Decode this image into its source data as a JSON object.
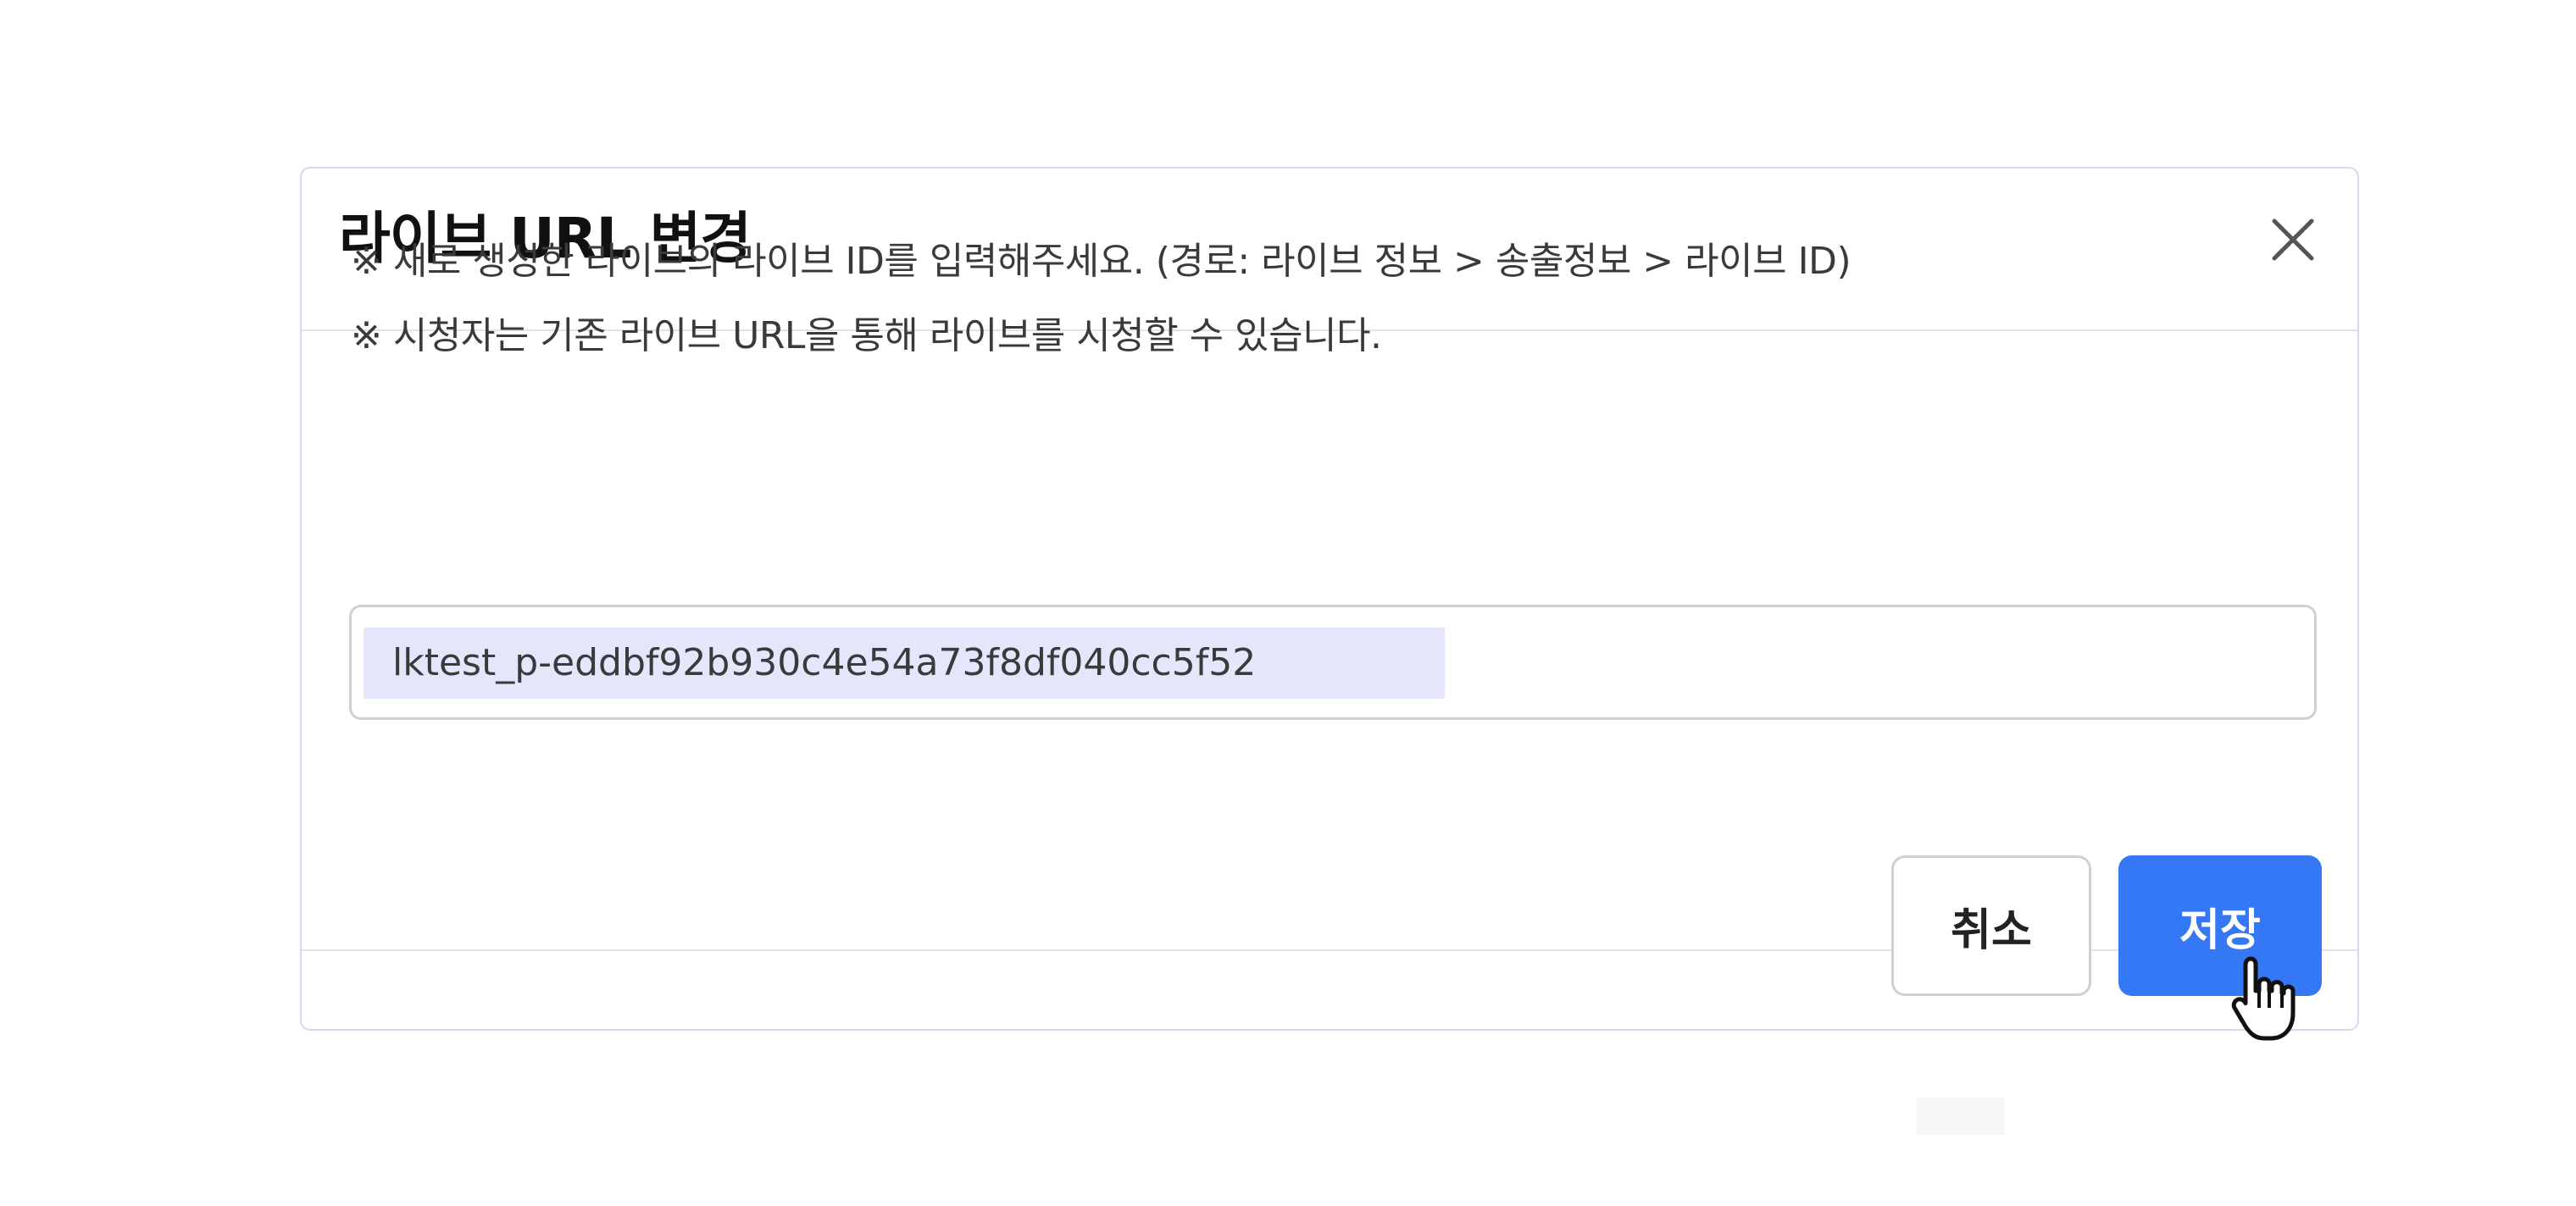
{
  "dialog": {
    "title": "라이브 URL 변경",
    "close_icon": "close-icon",
    "notices": [
      "※ 새로 생성한 라이브의 라이브 ID를 입력해주세요. (경로: 라이브 정보 > 송출정보 > 라이브 ID)",
      "※ 시청자는 기존 라이브 URL을 통해 라이브를 시청할 수 있습니다."
    ],
    "live_id_input": {
      "value": "lktest_p-eddbf92b930c4e54a73f8df040cc5f52"
    },
    "cancel_label": "취소",
    "save_label": "저장"
  },
  "colors": {
    "primary": "#3478f6",
    "selection": "#e4e6fb",
    "border": "#d6d8ee"
  },
  "cursor_icon": "hand-pointer-icon"
}
